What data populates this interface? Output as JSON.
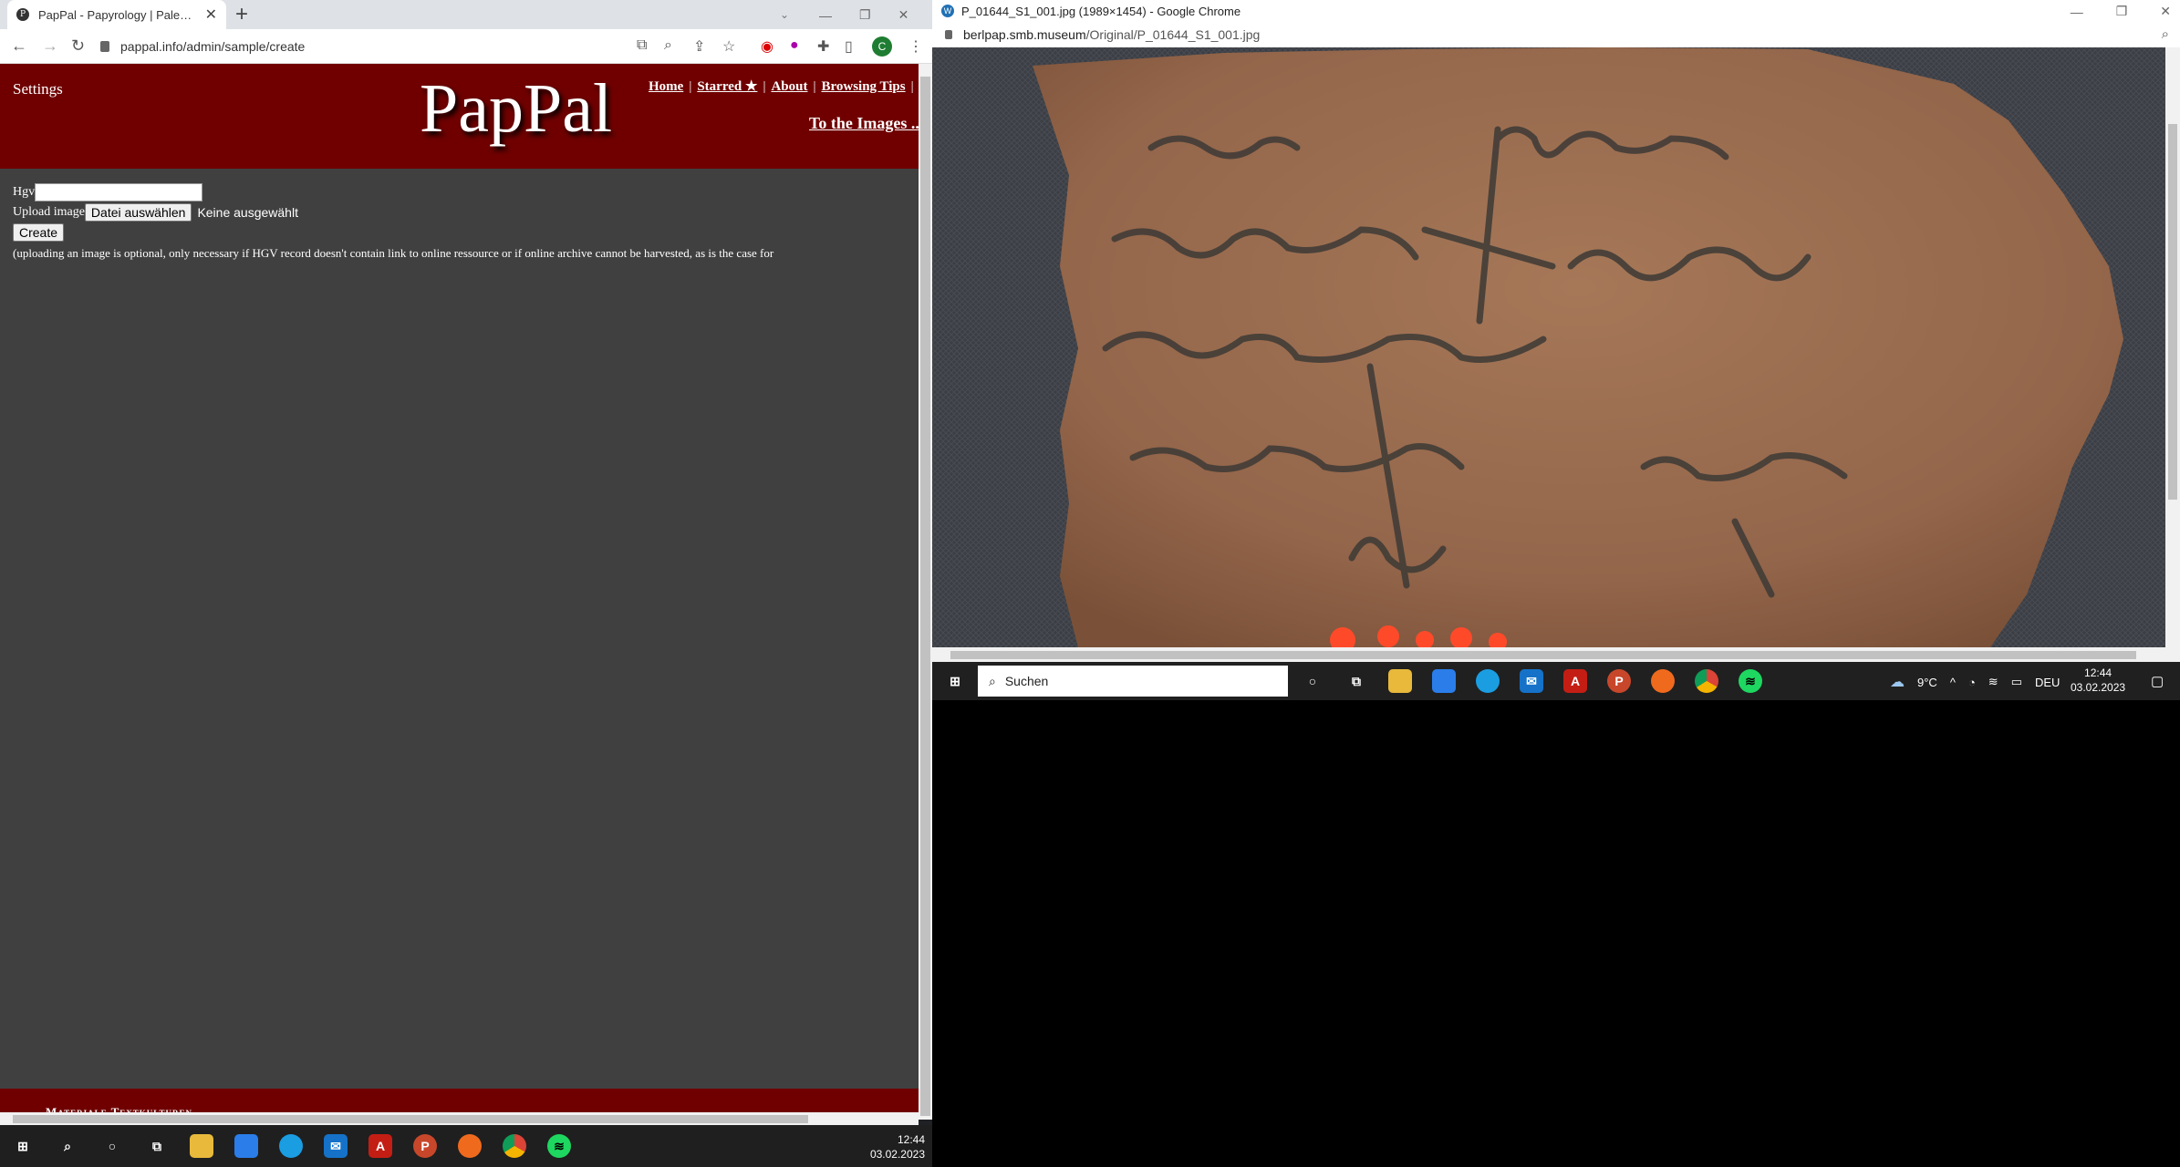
{
  "left_window": {
    "tab_title": "PapPal - Papyrology | Paleograph",
    "favicon_letter": "P",
    "url": "pappal.info/admin/sample/create",
    "profile_initial": "C"
  },
  "page": {
    "settings_label": "Settings",
    "logo": "PapPal",
    "nav": [
      "Home",
      "Starred ★",
      "About",
      "Browsing Tips"
    ],
    "to_images": "To the Images ...",
    "hgv_label": "Hgv",
    "upload_label": "Upload image",
    "choose_file": "Datei auswählen",
    "no_file": "Keine ausgewählt",
    "create_button": "Create",
    "note": "(uploading an image is optional, only necessary if HGV record doesn't contain link to online ressource or if online archive cannot be harvested, as is the case for",
    "footer": "Materiale Textkulturen"
  },
  "left_taskbar": {
    "time": "12:44",
    "date": "03.02.2023"
  },
  "right_window": {
    "title": "P_01644_S1_001.jpg (1989×1454) - Google Chrome",
    "url_domain": "berlpap.smb.museum",
    "url_path": "/Original/P_01644_S1_001.jpg"
  },
  "right_taskbar": {
    "search_placeholder": "Suchen",
    "temperature": "9°C",
    "language": "DEU",
    "time": "12:44",
    "date": "03.02.2023"
  },
  "icons": [
    "windows-icon",
    "search-icon",
    "cortana-icon",
    "task-view-icon",
    "explorer-icon",
    "store-icon",
    "edge-icon",
    "mail-icon",
    "acrobat-icon",
    "powerpoint-icon",
    "firefox-icon",
    "chrome-icon",
    "spotify-icon"
  ]
}
